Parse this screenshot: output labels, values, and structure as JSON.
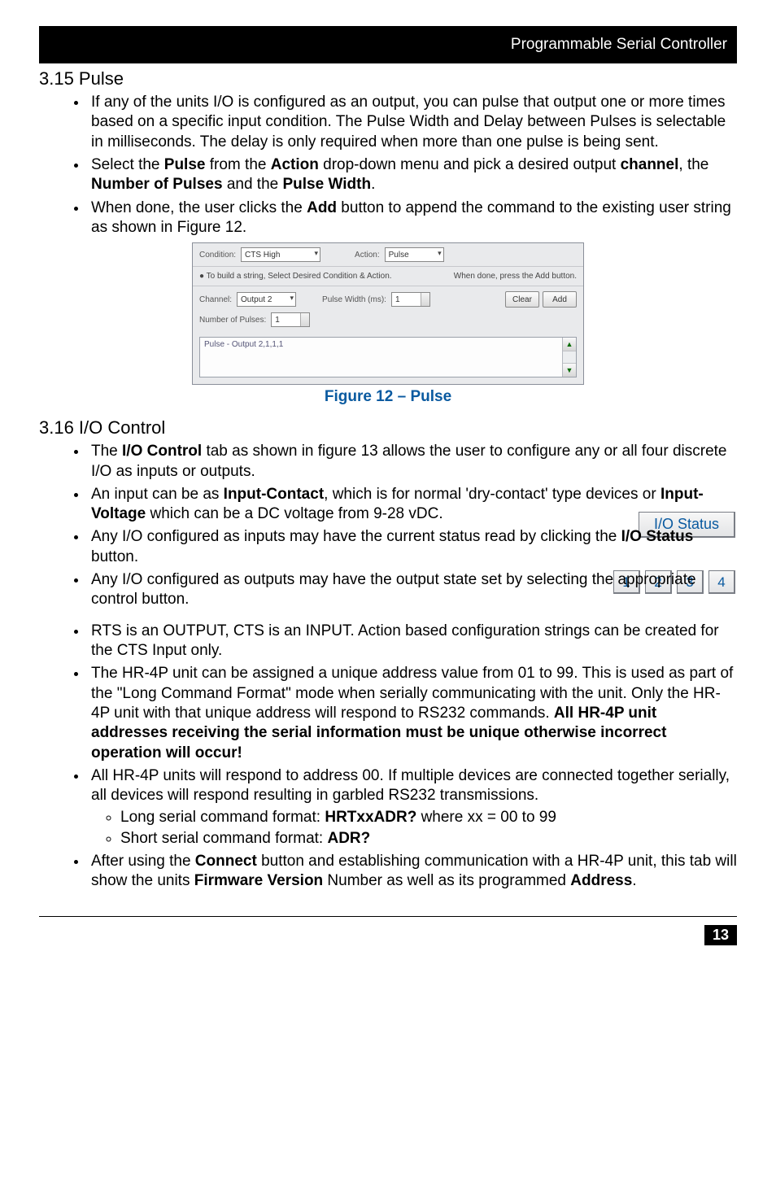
{
  "header": {
    "title": "Programmable Serial Controller"
  },
  "section_pulse": {
    "title": "3.15 Pulse",
    "b1": "If any of the units I/O is configured as an output, you can pulse that output one or more times based on a specific input condition.  The Pulse Width and Delay between Pulses is selectable in milliseconds. The delay is only required when more than one pulse is being sent.",
    "b2_pre": "Select the ",
    "b2_bold1": "Pulse",
    "b2_mid1": " from the ",
    "b2_bold2": "Action",
    "b2_mid2": " drop-down menu and pick a desired output ",
    "b2_bold3": "channel",
    "b2_mid3": ", the ",
    "b2_bold4": "Number of Pulses",
    "b2_mid4": " and the ",
    "b2_bold5": "Pulse Width",
    "b2_end": ".",
    "b3_pre": "When done, the user clicks the ",
    "b3_bold": "Add",
    "b3_end": " button to append the command to the existing user string as shown in Figure 12."
  },
  "mini": {
    "cond_label": "Condition:",
    "cond_value": "CTS High",
    "action_label": "Action:",
    "action_value": "Pulse",
    "hint_left": "●  To build a string, Select Desired Condition & Action.",
    "hint_right": "When done, press the Add button.",
    "channel_label": "Channel:",
    "channel_value": "Output 2",
    "pw_label": "Pulse Width (ms):",
    "pw_value": "1",
    "np_label": "Number of Pulses:",
    "np_value": "1",
    "clear_btn": "Clear",
    "add_btn": "Add",
    "ta_text": "Pulse - Output 2,1,1,1"
  },
  "figure12": "Figure 12 – Pulse",
  "section_io": {
    "title": "3.16 I/O Control",
    "b1_pre": "The ",
    "b1_bold": "I/O Control",
    "b1_end": " tab as shown in figure 13 allows the user to configure any or all four discrete I/O as inputs or outputs.",
    "b2_pre": "An input can be as ",
    "b2_bold1": "Input-Contact",
    "b2_mid": ", which is for normal 'dry-contact' type devices or ",
    "b2_bold2": "Input-Voltage",
    "b2_end": " which can be a DC voltage from 9-28 vDC.",
    "b3_pre": "Any I/O configured as inputs may have the current status read by clicking the ",
    "b3_bold": "I/O Status",
    "b3_end": " button.",
    "io_status_btn": "I/O Status",
    "b4": "Any I/O configured as outputs may have the output state set by selecting the appropriate control button.",
    "num1": "1",
    "num2": "2",
    "num3": "3",
    "num4": "4",
    "b5": "RTS is an OUTPUT, CTS is an INPUT. Action based configuration strings can be created for the CTS Input only.",
    "b6_pre": "The HR-4P unit can be assigned a unique address value from 01 to 99.  This is used as part of the \"Long Command Format\" mode when serially communicating with the unit. Only the HR-4P unit with that unique address will respond to RS232 commands. ",
    "b6_bold": "All HR-4P unit addresses receiving the serial information must be unique otherwise incorrect operation will occur!",
    "b7": "All HR-4P units will respond to address 00.  If multiple devices are connected together serially, all devices will respond resulting in garbled RS232 transmissions.",
    "b7a_pre": "Long serial command format: ",
    "b7a_bold": "HRTxxADR?",
    "b7a_end": "  where xx = 00 to 99",
    "b7b_pre": "Short serial command format: ",
    "b7b_bold": "ADR?",
    "b8_pre": "After using the ",
    "b8_bold1": "Connect",
    "b8_mid1": " button and establishing communication with a HR-4P unit, this tab will show the units ",
    "b8_bold2": "Firmware Version",
    "b8_mid2": " Number as well as its programmed ",
    "b8_bold3": "Address",
    "b8_end": "."
  },
  "page_number": "13"
}
